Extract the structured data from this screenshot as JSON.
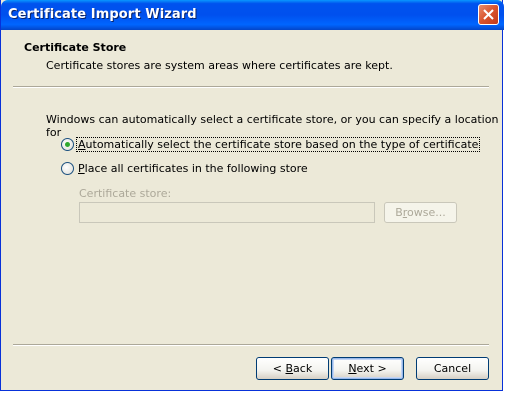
{
  "window": {
    "title": "Certificate Import Wizard"
  },
  "header": {
    "title": "Certificate Store",
    "description": "Certificate stores are system areas where certificates are kept."
  },
  "main": {
    "intro": "Windows can automatically select a certificate store, or you can specify a location for",
    "options": [
      {
        "mnemonic": "A",
        "rest": "utomatically select the certificate store based on the type of certificate",
        "checked": true
      },
      {
        "mnemonic": "P",
        "rest": "lace all certificates in the following store",
        "checked": false
      }
    ],
    "store_label": "Certificate store:",
    "store_value": "",
    "browse_mnemonic": "r",
    "browse_before": "B",
    "browse_after": "owse..."
  },
  "footer": {
    "back_before": "< ",
    "back_mnemonic": "B",
    "back_after": "ack",
    "next_mnemonic": "N",
    "next_after": "ext >",
    "cancel": "Cancel"
  },
  "colors": {
    "titlebar": "#0053ee",
    "close": "#d9532c",
    "window": "#ece9d8",
    "disabled_text": "#aca899",
    "radio_dot": "#2fa82f"
  }
}
